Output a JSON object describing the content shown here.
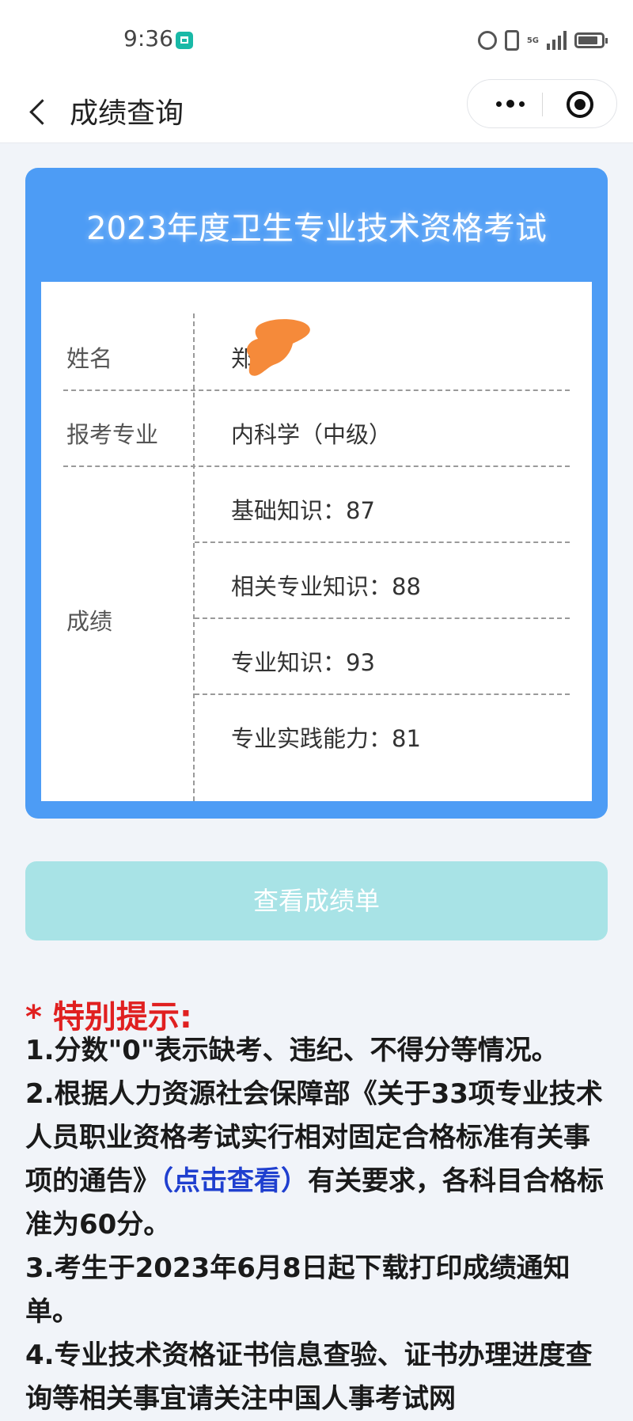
{
  "status_bar": {
    "time": "9:36",
    "network": "5G",
    "icons": [
      "app-badge-icon",
      "alarm-icon",
      "vibrate-icon",
      "signal-icon",
      "battery-icon"
    ]
  },
  "nav": {
    "title": "成绩查询",
    "back_icon": "chevron-left-icon",
    "more_icon": "more-dots-icon",
    "close_icon": "target-close-icon"
  },
  "card": {
    "title": "2023年度卫生专业技术资格考试",
    "rows": {
      "name_label": "姓名",
      "name_value": "郑",
      "major_label": "报考专业",
      "major_value": "内科学（中级）",
      "score_label": "成绩"
    },
    "scores": [
      "基础知识：87",
      "相关专业知识：88",
      "专业知识：93",
      "专业实践能力：81"
    ]
  },
  "button": {
    "label": "查看成绩单"
  },
  "notice": {
    "title": "* 特别提示:",
    "item1": "1.分数\"0\"表示缺考、违纪、不得分等情况。",
    "item2_pre": "2.根据人力资源社会保障部《关于33项专业技术人员职业资格考试实行相对固定合格标准有关事项的通告》",
    "item2_link": "（点击查看）",
    "item2_post": "有关要求，各科目合格标准为60分。",
    "item3": "3.考生于2023年6月8日起下载打印成绩通知单。",
    "item4": "4.专业技术资格证书信息查验、证书办理进度查询等相关事宜请关注中国人事考试网"
  },
  "colors": {
    "card_blue": "#4d9cf5",
    "button_teal": "#a8e3e6",
    "notice_red": "#e02020",
    "link_blue": "#1f3fcf",
    "redaction_orange": "#f58a3a"
  }
}
